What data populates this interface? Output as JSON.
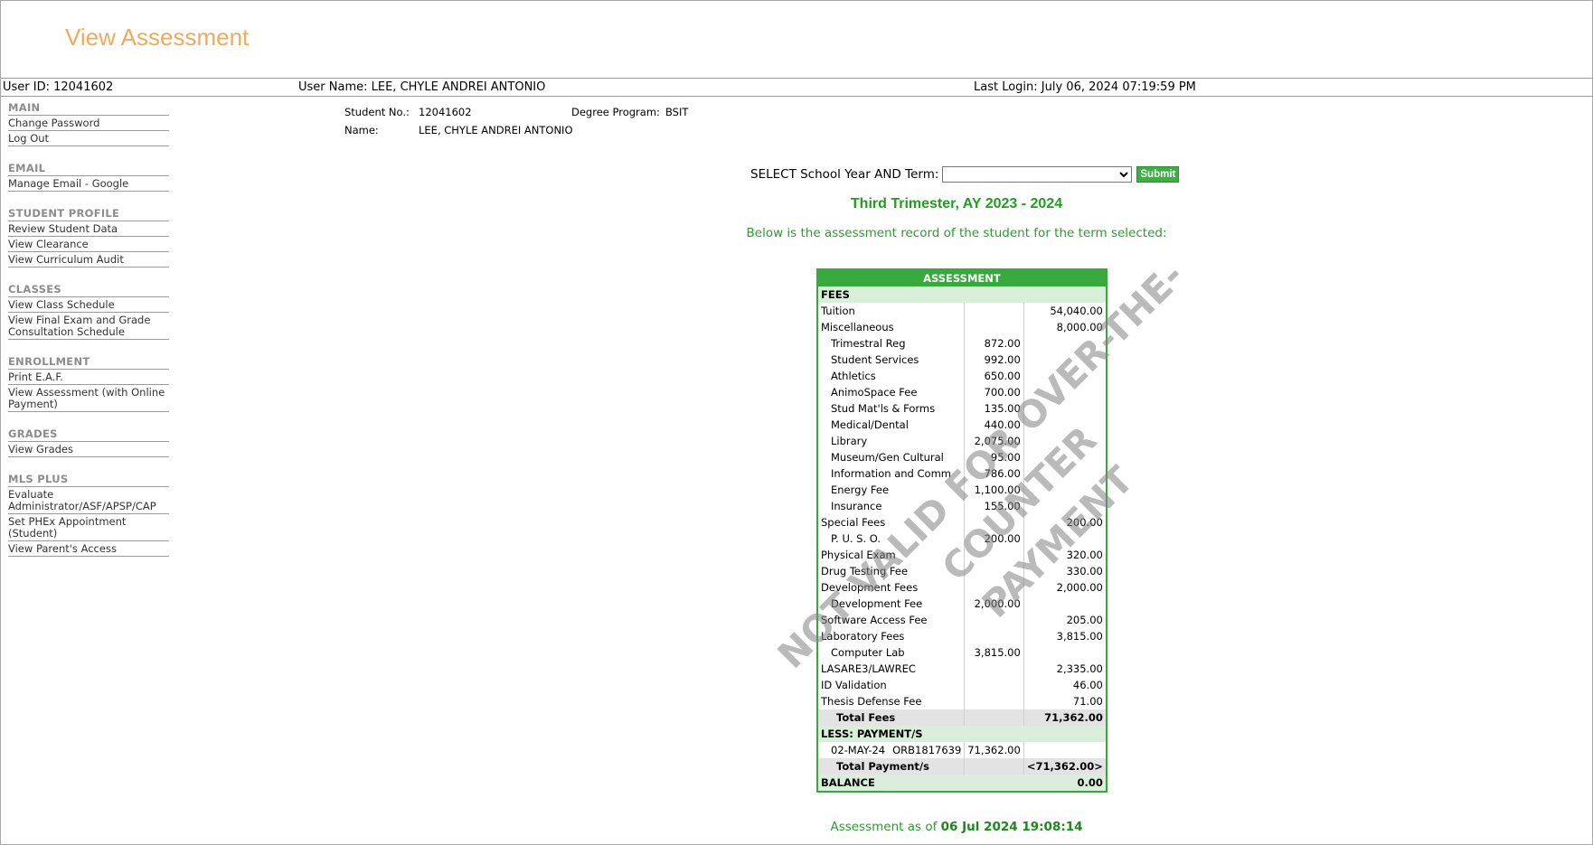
{
  "page_title": "View Assessment",
  "userbar": {
    "user_id": "User ID: 12041602",
    "user_name": "User Name: LEE, CHYLE ANDREI ANTONIO",
    "last_login": "Last Login: July 06, 2024 07:19:59 PM"
  },
  "sidebar": [
    {
      "title": "MAIN",
      "items": [
        "Change Password",
        "Log Out"
      ]
    },
    {
      "title": "EMAIL",
      "items": [
        "Manage Email - Google"
      ]
    },
    {
      "title": "STUDENT PROFILE",
      "items": [
        "Review Student Data",
        "View Clearance",
        "View Curriculum Audit"
      ]
    },
    {
      "title": "CLASSES",
      "items": [
        "View Class Schedule",
        "View Final Exam and Grade Consultation Schedule"
      ]
    },
    {
      "title": "ENROLLMENT",
      "items": [
        "Print E.A.F.",
        "View Assessment (with Online Payment)"
      ]
    },
    {
      "title": "GRADES",
      "items": [
        "View Grades"
      ]
    },
    {
      "title": "MLS PLUS",
      "items": [
        "Evaluate Administrator/ASF/APSP/CAP",
        "Set PHEx Appointment (Student)",
        "View Parent's Access"
      ]
    }
  ],
  "student": {
    "no_label": "Student No.:",
    "no_value": "12041602",
    "name_label": "Name:",
    "name_value": "LEE, CHYLE ANDREI ANTONIO",
    "degree_label": "Degree Program:",
    "degree_value": "BSIT"
  },
  "term_select": {
    "label": "SELECT School Year AND Term:",
    "selected": "",
    "submit_label": "Submit"
  },
  "term_title": "Third Trimester, AY 2023 - 2024",
  "term_subtitle": "Below is the assessment record of the student for the term selected:",
  "assessment": {
    "header": "ASSESSMENT",
    "fees_header": "FEES",
    "rows": [
      {
        "label": "Tuition",
        "sub": "",
        "amount": "54,040.00",
        "indent": false
      },
      {
        "label": "Miscellaneous",
        "sub": "",
        "amount": "8,000.00",
        "indent": false
      },
      {
        "label": "Trimestral Reg",
        "sub": "872.00",
        "amount": "",
        "indent": true
      },
      {
        "label": "Student Services",
        "sub": "992.00",
        "amount": "",
        "indent": true
      },
      {
        "label": "Athletics",
        "sub": "650.00",
        "amount": "",
        "indent": true
      },
      {
        "label": "AnimoSpace Fee",
        "sub": "700.00",
        "amount": "",
        "indent": true
      },
      {
        "label": "Stud Mat'ls & Forms",
        "sub": "135.00",
        "amount": "",
        "indent": true
      },
      {
        "label": "Medical/Dental",
        "sub": "440.00",
        "amount": "",
        "indent": true
      },
      {
        "label": "Library",
        "sub": "2,075.00",
        "amount": "",
        "indent": true
      },
      {
        "label": "Museum/Gen Cultural",
        "sub": "95.00",
        "amount": "",
        "indent": true
      },
      {
        "label": "Information and Comm",
        "sub": "786.00",
        "amount": "",
        "indent": true
      },
      {
        "label": "Energy Fee",
        "sub": "1,100.00",
        "amount": "",
        "indent": true
      },
      {
        "label": "Insurance",
        "sub": "155.00",
        "amount": "",
        "indent": true
      },
      {
        "label": "Special Fees",
        "sub": "",
        "amount": "200.00",
        "indent": false
      },
      {
        "label": "P. U. S. O.",
        "sub": "200.00",
        "amount": "",
        "indent": true
      },
      {
        "label": "Physical Exam",
        "sub": "",
        "amount": "320.00",
        "indent": false
      },
      {
        "label": "Drug Testing Fee",
        "sub": "",
        "amount": "330.00",
        "indent": false
      },
      {
        "label": "Development Fees",
        "sub": "",
        "amount": "2,000.00",
        "indent": false
      },
      {
        "label": "Development Fee",
        "sub": "2,000.00",
        "amount": "",
        "indent": true
      },
      {
        "label": "Software Access Fee",
        "sub": "",
        "amount": "205.00",
        "indent": false
      },
      {
        "label": "Laboratory Fees",
        "sub": "",
        "amount": "3,815.00",
        "indent": false
      },
      {
        "label": "Computer Lab",
        "sub": "3,815.00",
        "amount": "",
        "indent": true
      },
      {
        "label": "LASARE3/LAWREC",
        "sub": "",
        "amount": "2,335.00",
        "indent": false
      },
      {
        "label": "ID Validation",
        "sub": "",
        "amount": "46.00",
        "indent": false
      },
      {
        "label": "Thesis Defense Fee",
        "sub": "",
        "amount": "71.00",
        "indent": false
      }
    ],
    "total_fees_label": "Total Fees",
    "total_fees_value": "71,362.00",
    "payments_header": "LESS: PAYMENT/S",
    "payments": [
      {
        "date": "02-MAY-24",
        "or": "ORB1817639",
        "amount": "71,362.00"
      }
    ],
    "total_payments_label": "Total Payment/s",
    "total_payments_value": "<71,362.00>",
    "balance_label": "BALANCE",
    "balance_value": "0.00"
  },
  "watermark": [
    "NOT VALID FOR OVER-THE-COUNTER",
    "PAYMENT"
  ],
  "as_of": {
    "prefix": "Assessment as of",
    "value": "06 Jul 2024 19:08:14"
  },
  "colors": {
    "title": "#f0aa5a",
    "accent_green": "#37a93d",
    "header_green": "#1ea01e"
  }
}
